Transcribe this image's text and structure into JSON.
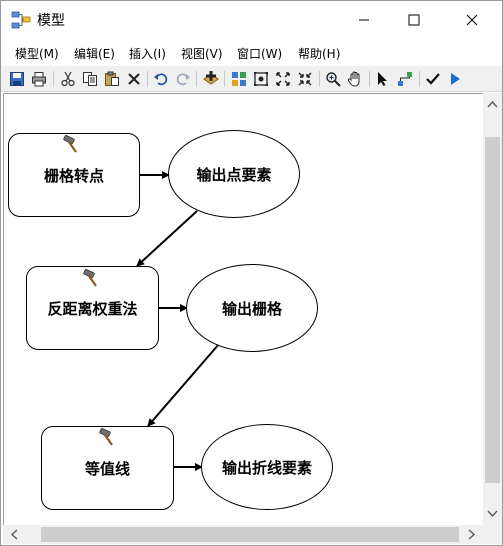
{
  "window": {
    "title": "模型",
    "controls": [
      "minimize-button",
      "maximize-button",
      "close-button"
    ]
  },
  "menu": {
    "items": [
      {
        "label": "模型(M)"
      },
      {
        "label": "编辑(E)"
      },
      {
        "label": "插入(I)"
      },
      {
        "label": "视图(V)"
      },
      {
        "label": "窗口(W)"
      },
      {
        "label": "帮助(H)"
      }
    ]
  },
  "toolbar": {
    "icons": [
      "save-icon",
      "print-icon",
      "cut-icon",
      "copy-icon",
      "paste-icon",
      "delete-icon",
      "undo-icon",
      "redo-icon",
      "add-data-icon",
      "auto-layout-icon",
      "full-extent-icon",
      "zoom-in-fixed-icon",
      "zoom-out-fixed-icon",
      "zoom-icon",
      "pan-icon",
      "select-icon",
      "connect-icon",
      "validate-icon",
      "run-icon"
    ]
  },
  "model": {
    "nodes": [
      {
        "id": "tool-1",
        "kind": "tool",
        "label": "栅格转点"
      },
      {
        "id": "data-1",
        "kind": "data",
        "label": "输出点要素"
      },
      {
        "id": "tool-2",
        "kind": "tool",
        "label": "反距离权重法"
      },
      {
        "id": "data-2",
        "kind": "data",
        "label": "输出栅格"
      },
      {
        "id": "tool-3",
        "kind": "tool",
        "label": "等值线"
      },
      {
        "id": "data-3",
        "kind": "data",
        "label": "输出折线要素"
      }
    ],
    "connections": [
      {
        "from": "tool-1",
        "to": "data-1"
      },
      {
        "from": "data-1",
        "to": "tool-2"
      },
      {
        "from": "tool-2",
        "to": "data-2"
      },
      {
        "from": "data-2",
        "to": "tool-3"
      },
      {
        "from": "tool-3",
        "to": "data-3"
      }
    ]
  },
  "colors": {
    "toolbar_bg": "#f0f0f0",
    "canvas_bg": "#ffffff",
    "node_border": "#000000",
    "run_blue": "#1f6fd1"
  }
}
